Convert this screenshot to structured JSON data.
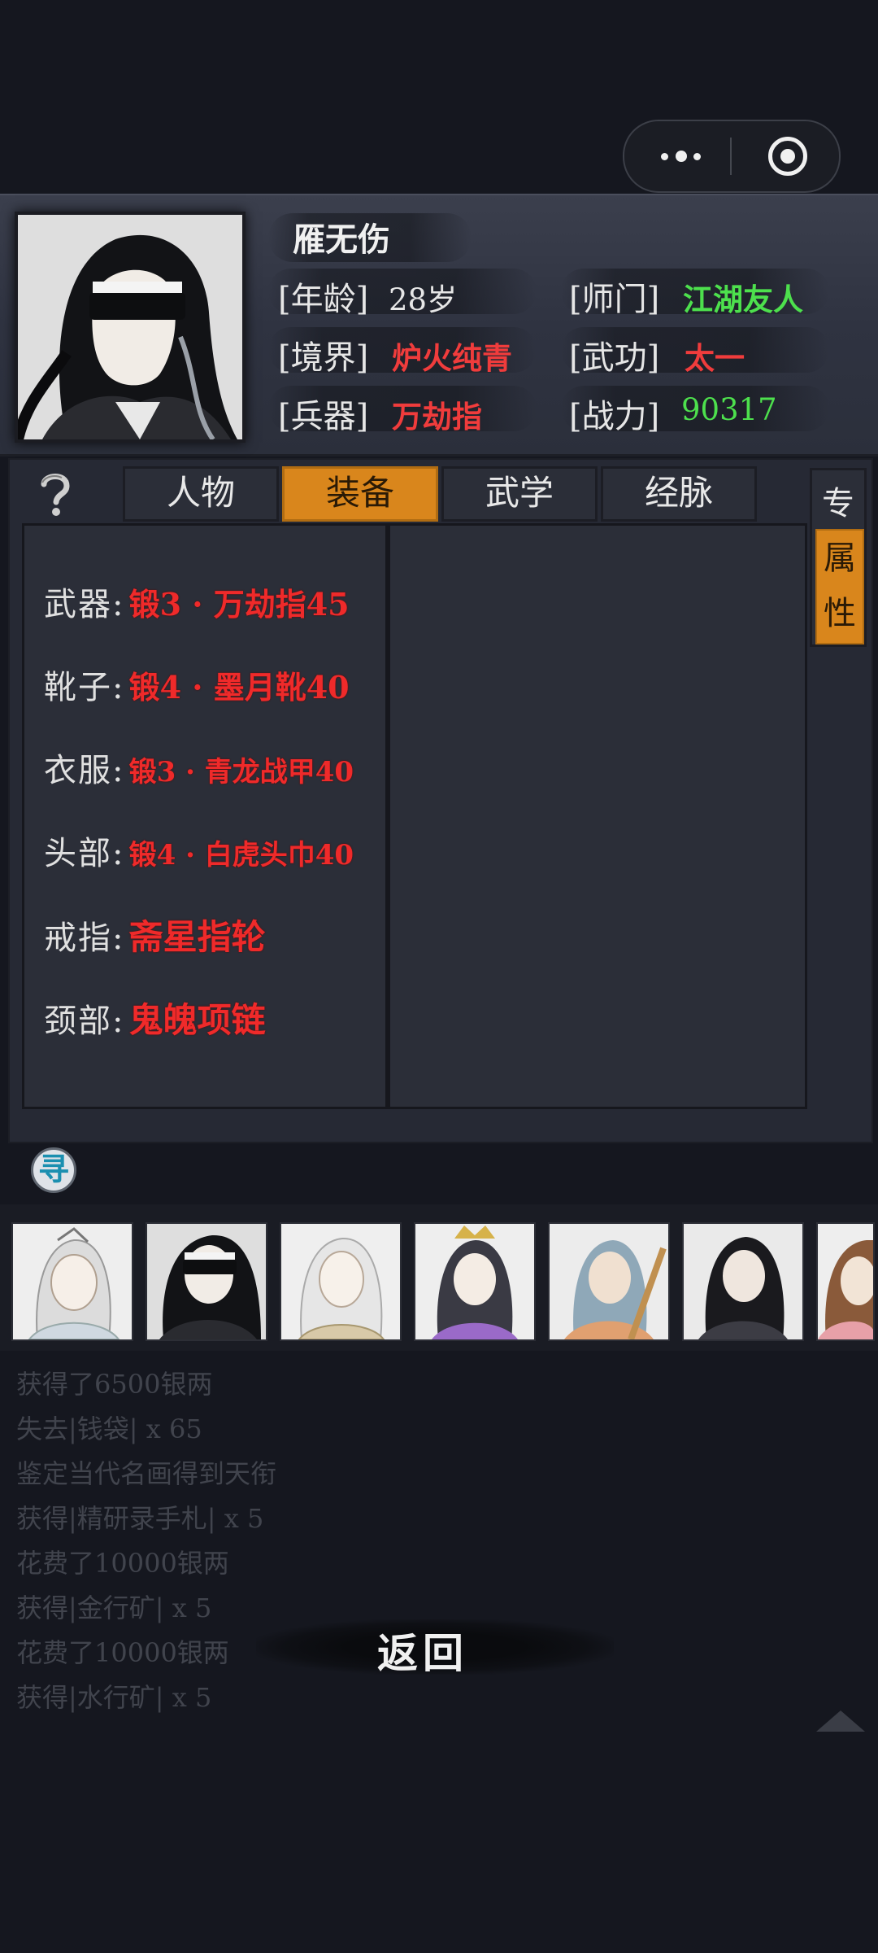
{
  "hero": {
    "name": "雁无伤",
    "age_label": "[年龄]",
    "age_value": "28岁",
    "sect_label": "[师门]",
    "sect_value": "江湖友人",
    "realm_label": "[境界]",
    "realm_value": "炉火纯青",
    "skill_label": "[武功]",
    "skill_value": "太一",
    "weapon_label": "[兵器]",
    "weapon_value": "万劫指",
    "power_label": "[战力]",
    "power_value": "90317"
  },
  "help_icon": "question-icon",
  "tabs": [
    {
      "label": "人物",
      "active": false
    },
    {
      "label": "装备",
      "active": true
    },
    {
      "label": "武学",
      "active": false
    },
    {
      "label": "经脉",
      "active": false
    }
  ],
  "side_tabs": {
    "top": "专",
    "active_line1": "属",
    "active_line2": "性"
  },
  "equipment": [
    {
      "label": "武器:",
      "value": "锻3 · 万劫指45"
    },
    {
      "label": "靴子:",
      "value": "锻4 · 墨月靴40"
    },
    {
      "label": "衣服:",
      "value": "锻3 · 青龙战甲40"
    },
    {
      "label": "头部:",
      "value": "锻4 · 白虎头巾40"
    },
    {
      "label": "戒指:",
      "value": "斋星指轮"
    },
    {
      "label": "颈部:",
      "value": "鬼魄项链"
    }
  ],
  "search_button": "寻",
  "log": [
    "获得了6500银两",
    "失去|钱袋| x 65",
    "鉴定当代名画得到天衔",
    "获得|精研录手札| x 5",
    "花费了10000银两",
    "获得|金行矿| x 5",
    "花费了10000银两",
    "获得|水行矿| x 5"
  ],
  "back_label": "返回",
  "colors": {
    "accent": "#d9861c",
    "red": "#f03c3c",
    "green": "#4de04d",
    "background": "#15171f"
  }
}
